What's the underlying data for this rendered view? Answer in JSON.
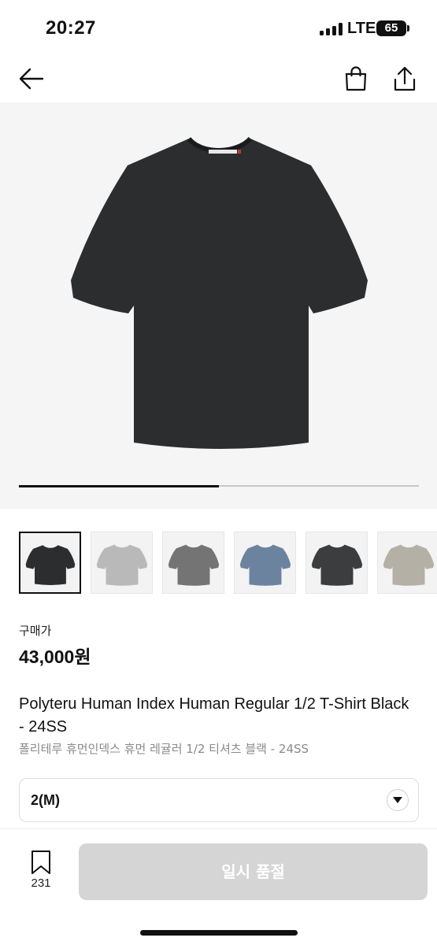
{
  "status_bar": {
    "time": "20:27",
    "network": "LTE",
    "battery": "65"
  },
  "nav": {
    "back_icon": "arrow-left-icon",
    "bag_icon": "shopping-bag-icon",
    "share_icon": "share-icon"
  },
  "gallery": {
    "main_color": "#2b2d2f",
    "progress_fraction": 0.5
  },
  "thumbnails": [
    {
      "color": "#2b2d2f",
      "selected": true
    },
    {
      "color": "#b9b9ba",
      "selected": false
    },
    {
      "color": "#747474",
      "selected": false
    },
    {
      "color": "#6c83a0",
      "selected": false
    },
    {
      "color": "#3c3d3e",
      "selected": false
    },
    {
      "color": "#b5b0a6",
      "selected": false
    }
  ],
  "price": {
    "label": "구매가",
    "value": "43,000원"
  },
  "product": {
    "name_en": "Polyteru Human Index Human Regular 1/2 T-Shirt Black - 24SS",
    "name_ko": "폴리테루 휴먼인덱스 휴먼 레귤러 1/2 티셔츠 블랙 - 24SS"
  },
  "size_select": {
    "value": "2(M)"
  },
  "bottom": {
    "wish_count": "231",
    "cta_label": "일시 품절",
    "cta_color": "#d5d5d5"
  }
}
